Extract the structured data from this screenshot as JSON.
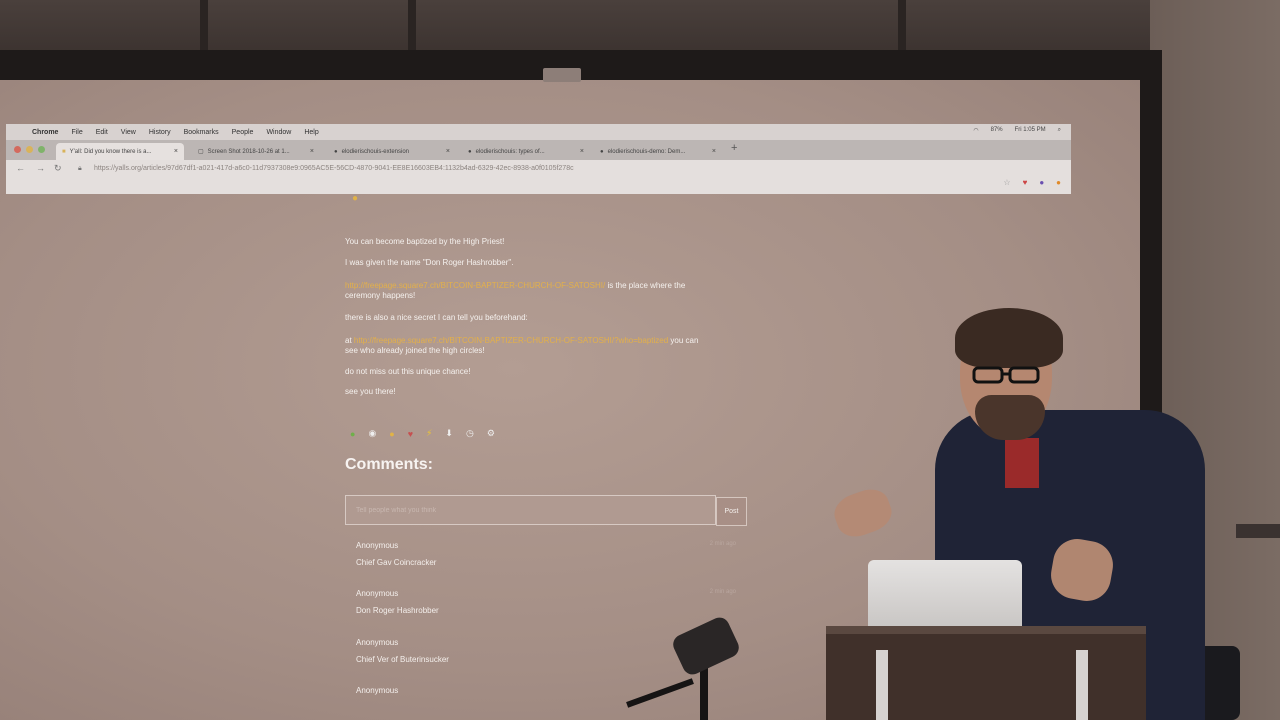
{
  "menubar": {
    "items": [
      "Chrome",
      "File",
      "Edit",
      "View",
      "History",
      "Bookmarks",
      "People",
      "Window",
      "Help"
    ],
    "clock": "Fri 1:05 PM",
    "battery": "87%"
  },
  "tabs": [
    {
      "label": "Y'all: Did you know there is a..."
    },
    {
      "label": "Screen Shot 2018-10-26 at 1..."
    },
    {
      "label": "elodierischouis-extension"
    },
    {
      "label": "elodierischouis: types of..."
    },
    {
      "label": "elodierischouis-demo: Dem..."
    }
  ],
  "address": {
    "url": "https://yalls.org/articles/97d67df1-a021-417d-a6c0-11d7937308e9:0965AC5E-56CD-4870-9041-EE8E16603EB4:1132b4ad-6329-42ec-8938-a0f0105f278c"
  },
  "article": {
    "line1": "You can become baptized by the High Priest!",
    "line2": "I was given the name \"Don Roger Hashrobber\".",
    "link1": "http://freepage.square7.ch/BITCOIN-BAPTIZER-CHURCH-OF-SATOSHI/",
    "line3_after": " is the place where the",
    "line3_cont": "ceremony happens!",
    "line4": "there is also a nice secret I can tell you beforehand:",
    "line5_pre": "at ",
    "link2": "http://freepage.square7.ch/BITCOIN-BAPTIZER-CHURCH-OF-SATOSHI/?who=baptized",
    "line5_after": " you can",
    "line5_cont": "see who already joined the high circles!",
    "line6": "do not miss out this unique chance!",
    "line7": "see you there!"
  },
  "comments": {
    "title": "Comments:",
    "placeholder": "Tell people what you think",
    "post_label": "Post",
    "items": [
      {
        "author": "Anonymous",
        "body": "Chief Gav Coincracker",
        "time": "2 min ago"
      },
      {
        "author": "Anonymous",
        "body": "Don Roger Hashrobber",
        "time": "2 min ago"
      },
      {
        "author": "Anonymous",
        "body": "Chief Ver of Buterinsucker",
        "time": ""
      },
      {
        "author": "Anonymous",
        "body": "",
        "time": ""
      }
    ]
  },
  "colors": {
    "link": "#e3b04a",
    "screen": "#a79188",
    "text": "#f5f1ee"
  }
}
